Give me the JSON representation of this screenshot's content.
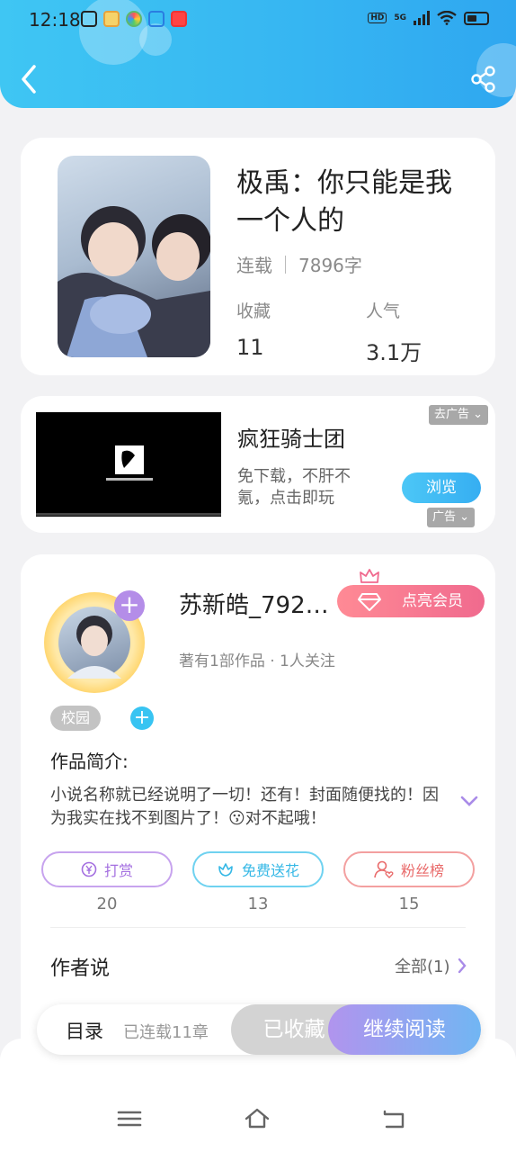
{
  "status_bar": {
    "time": "12:18",
    "network": "5G",
    "hd": "HD",
    "app_icons": [
      "app-icon",
      "weibo-icon",
      "colorful-app-icon",
      "app-icon",
      "video-app-icon"
    ]
  },
  "header": {
    "accent": "#36b5f2"
  },
  "book": {
    "title": "极禹：你只能是我一个人的",
    "status": "连载",
    "word_count": "7896字",
    "favorites_label": "收藏",
    "favorites_value": "11",
    "popularity_label": "人气",
    "popularity_value": "3.1万"
  },
  "ad": {
    "remove_label": "去广告",
    "title": "疯狂骑士团",
    "description": "免下载，不肝不氪，点击即玩",
    "browse_label": "浏览",
    "ad_mark": "广告"
  },
  "author": {
    "name": "苏新皓_792…",
    "vip_label": "点亮会员",
    "stats": "著有1部作品 · 1人关注",
    "tag": "校园",
    "intro_label": "作品简介:",
    "intro_text": "小说名称就已经说明了一切！还有！封面随便找的！因为我实在找不到图片了！😗对不起哦！",
    "reward_label": "打赏",
    "reward_count": "20",
    "flower_label": "免费送花",
    "flower_count": "13",
    "fans_label": "粉丝榜",
    "fans_count": "15",
    "author_says_label": "作者说",
    "all_label": "全部(1)"
  },
  "reader_bar": {
    "toc_label": "目录",
    "chapter_count": "已连载11章",
    "collected_label": "已收藏",
    "continue_label": "继续阅读"
  }
}
